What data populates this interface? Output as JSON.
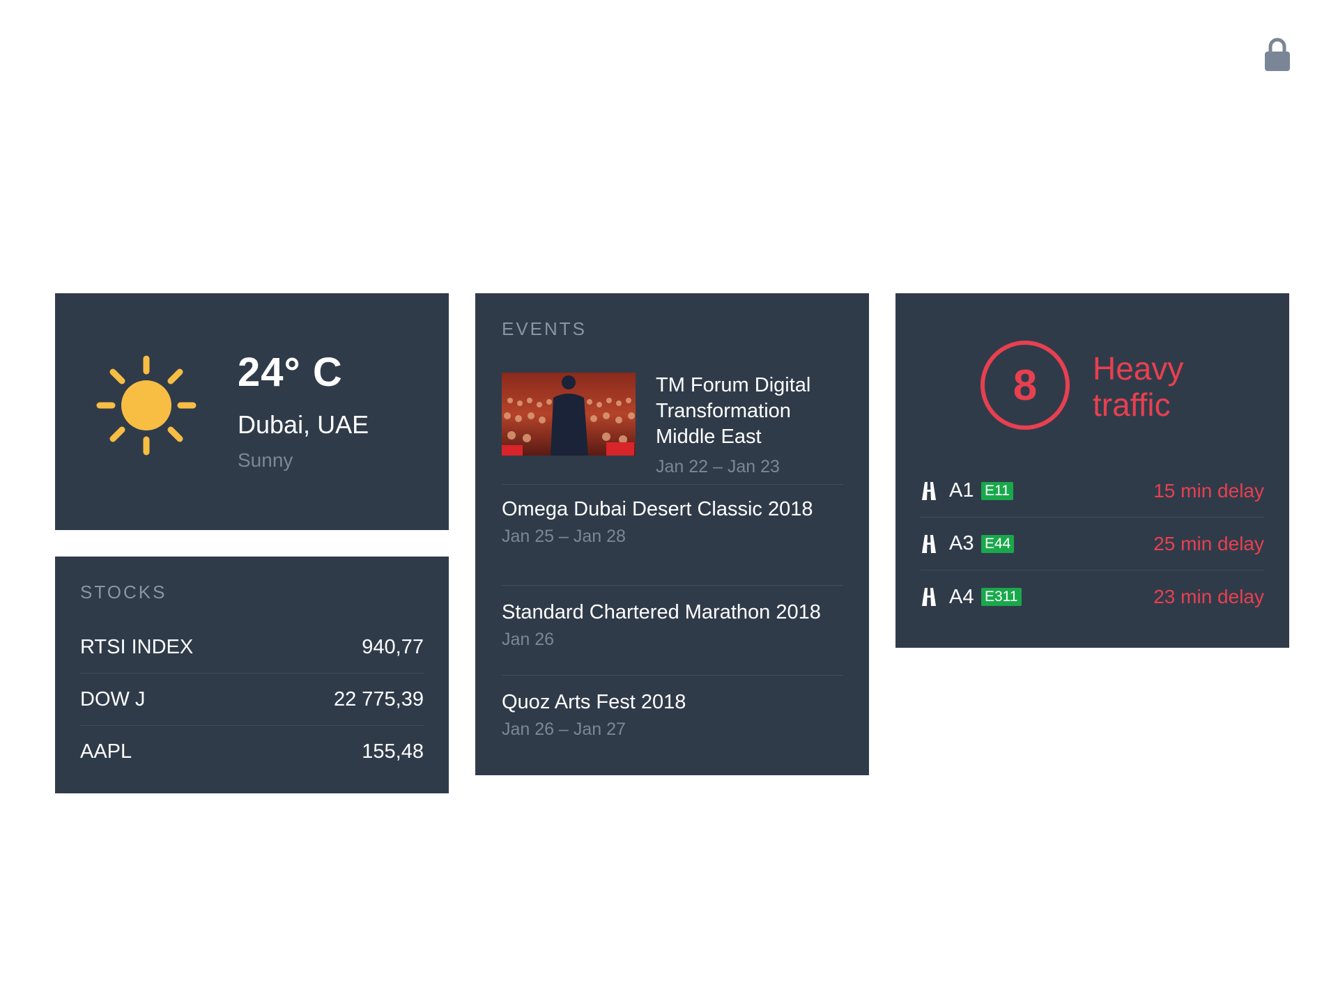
{
  "colors": {
    "card_bg": "#303b4a",
    "accent_red": "#e8404f",
    "sun_yellow": "#f7be43",
    "badge_green": "#19a84b",
    "muted_text": "#7c8796"
  },
  "header": {
    "lock_icon": "lock-icon"
  },
  "weather": {
    "icon": "sun-icon",
    "temperature": "24° C",
    "location": "Dubai, UAE",
    "condition": "Sunny"
  },
  "stocks": {
    "title": "STOCKS",
    "items": [
      {
        "name": "RTSI INDEX",
        "value": "940,77"
      },
      {
        "name": "DOW J",
        "value": "22 775,39"
      },
      {
        "name": "AAPL",
        "value": "155,48"
      }
    ]
  },
  "events": {
    "title": "EVENTS",
    "items": [
      {
        "name": "TM Forum Digital Transformation Middle East",
        "dates": "Jan 22 – Jan 23",
        "image": "conference-speaker-photo"
      },
      {
        "name": "Omega Dubai Desert Classic 2018",
        "dates": "Jan 25 – Jan 28"
      },
      {
        "name": "Standard Chartered Marathon 2018",
        "dates": "Jan 26"
      },
      {
        "name": "Quoz Arts Fest 2018",
        "dates": "Jan 26 – Jan 27"
      }
    ]
  },
  "traffic": {
    "score": "8",
    "status": "Heavy traffic",
    "roads": [
      {
        "icon": "road-icon",
        "name": "A1",
        "badge": "E11",
        "delay": "15 min delay"
      },
      {
        "icon": "road-icon",
        "name": "A3",
        "badge": "E44",
        "delay": "25 min delay"
      },
      {
        "icon": "road-icon",
        "name": "A4",
        "badge": "E311",
        "delay": "23 min delay"
      }
    ]
  }
}
